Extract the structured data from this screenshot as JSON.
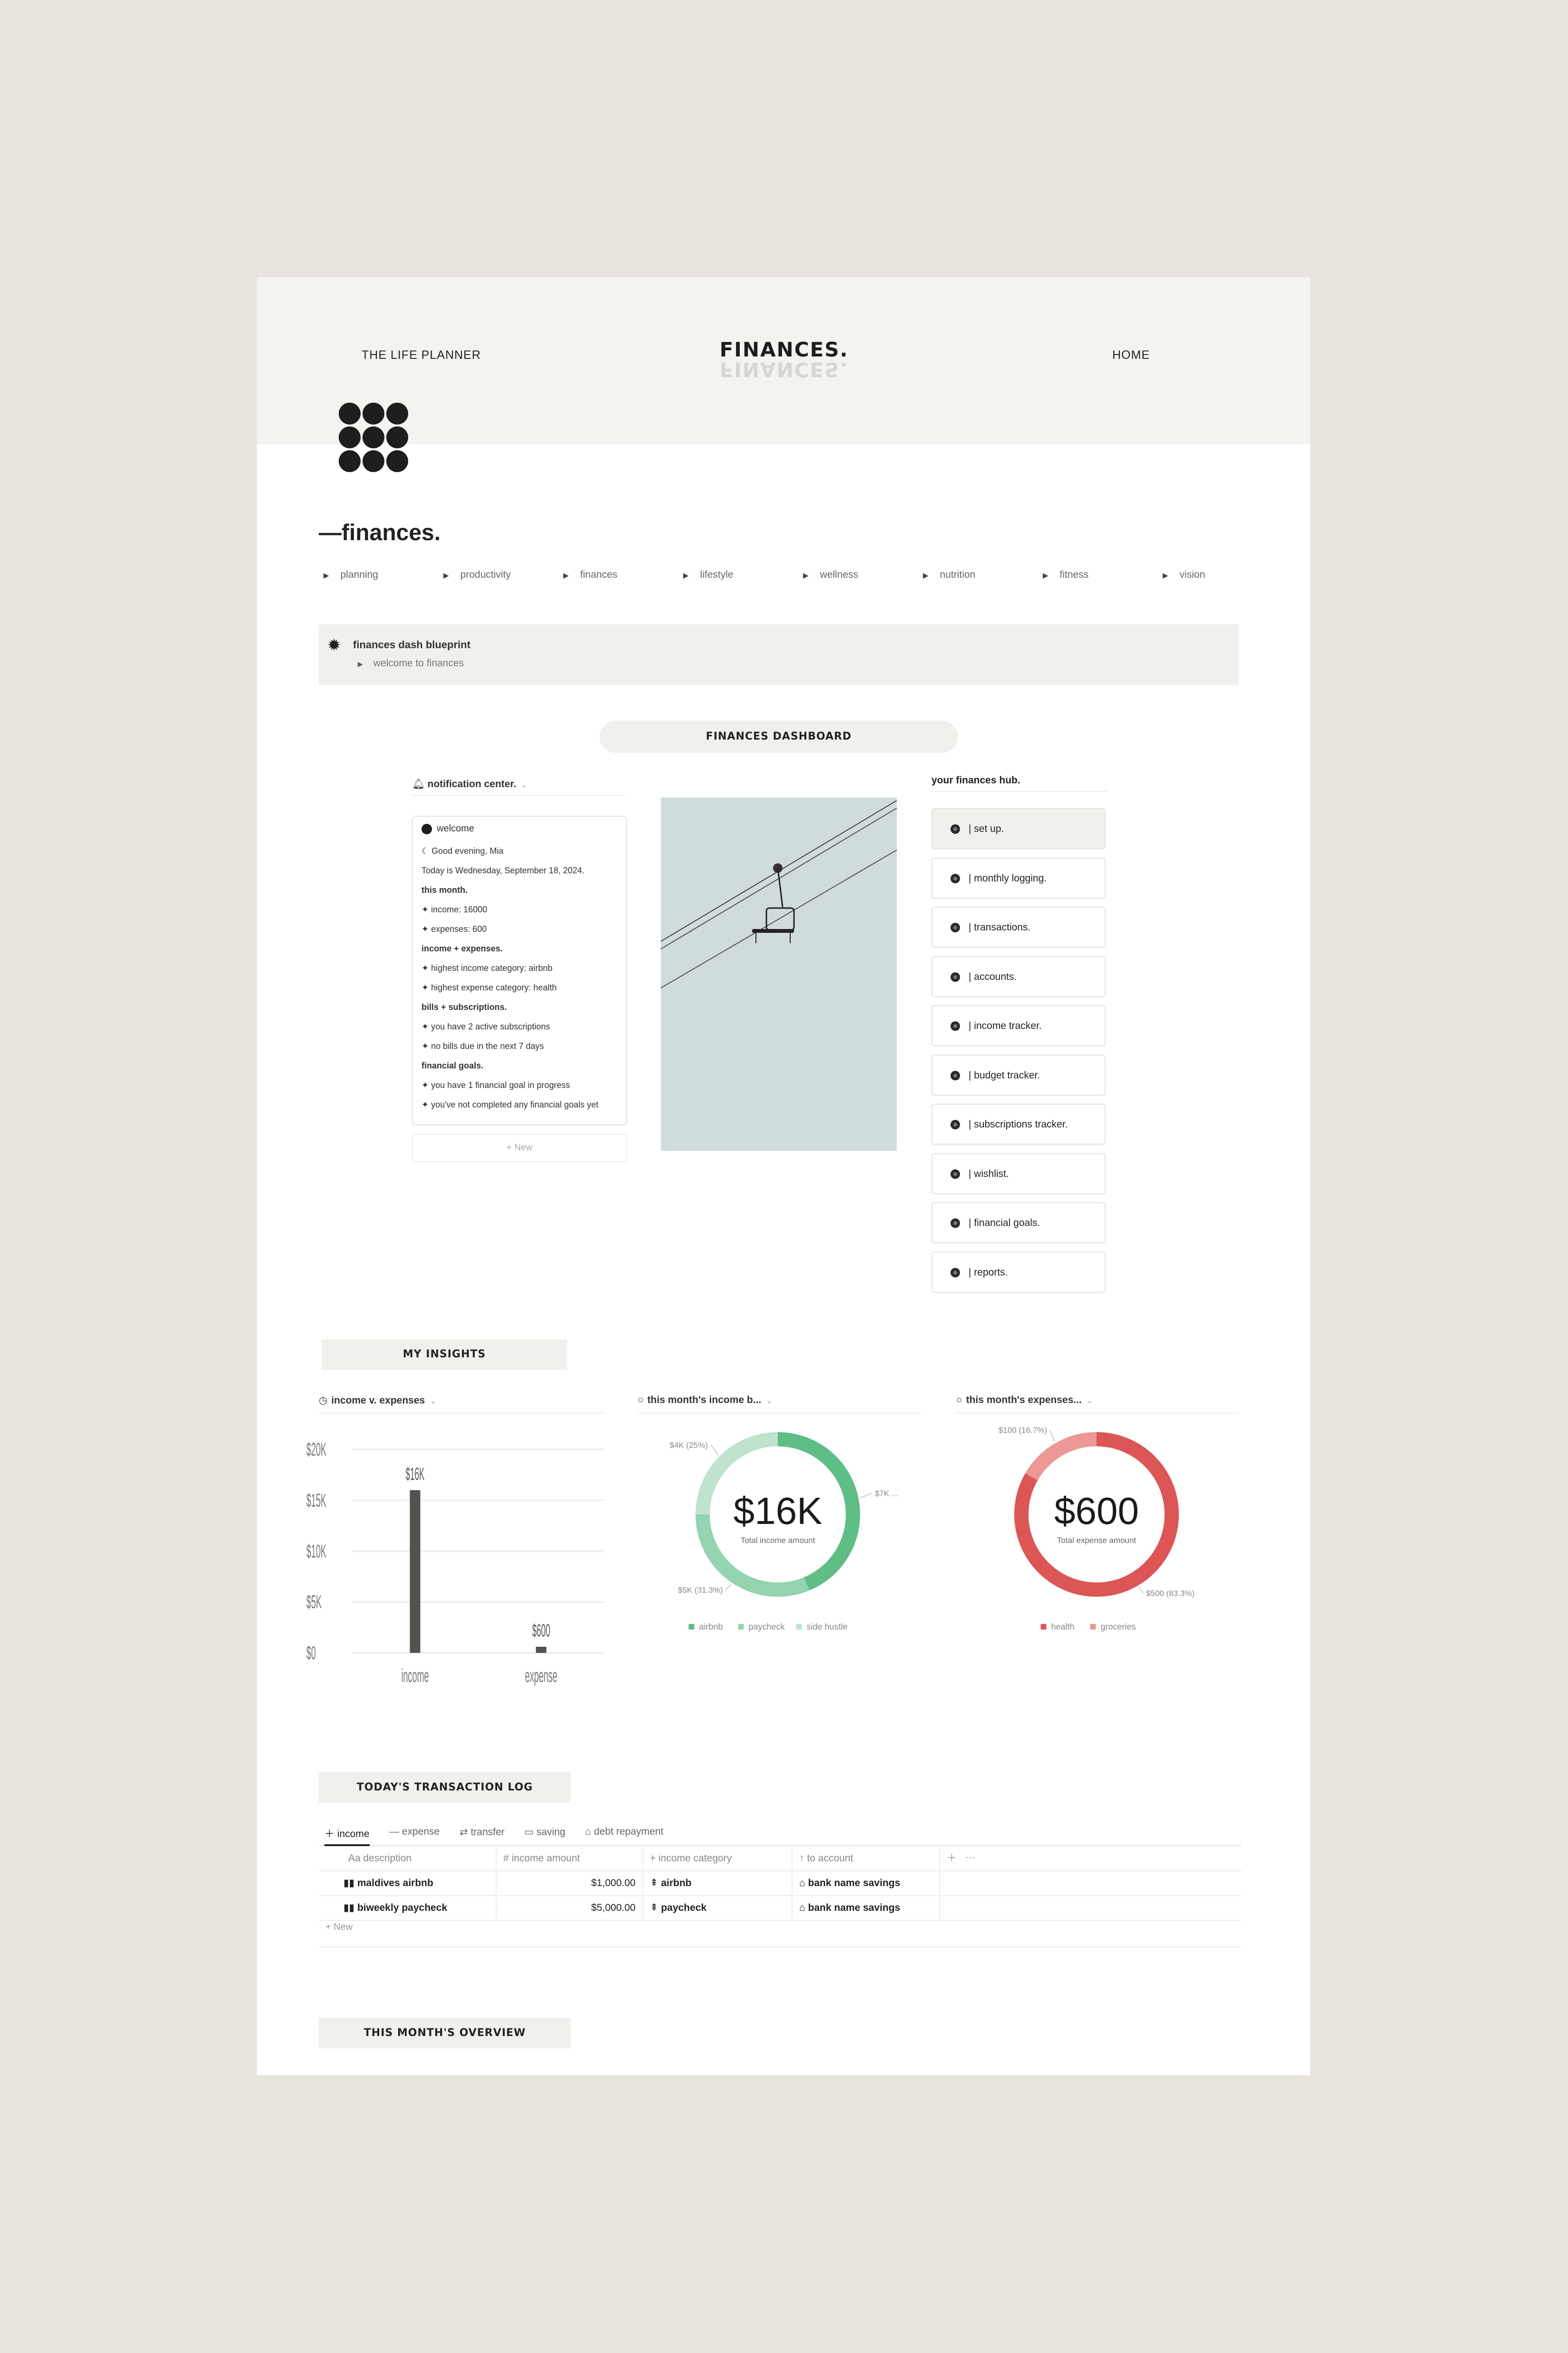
{
  "header": {
    "left_link": "THE LIFE PLANNER",
    "brand": "FINANCES.",
    "right_link": "HOME"
  },
  "page_title": "—finances.",
  "categories": [
    "planning",
    "productivity",
    "finances",
    "lifestyle",
    "wellness",
    "nutrition",
    "fitness",
    "vision"
  ],
  "blueprint": {
    "title": "finances dash blueprint",
    "sub": "welcome to finances"
  },
  "dashboard_label": "FINANCES DASHBOARD",
  "notification": {
    "header": "notification center.",
    "title": "welcome",
    "lines": [
      {
        "text": "Good evening, Mia",
        "bold": false,
        "icon": "moon-icon"
      },
      {
        "text": "Today is Wednesday, September 18, 2024.",
        "bold": false,
        "icon": ""
      },
      {
        "text": "this month.",
        "bold": true,
        "icon": ""
      },
      {
        "text": "income: 16000",
        "bold": false,
        "icon": "sparkle-icon"
      },
      {
        "text": "expenses: 600",
        "bold": false,
        "icon": "sparkle-icon"
      },
      {
        "text": "income + expenses.",
        "bold": true,
        "icon": ""
      },
      {
        "text": "highest income category: airbnb",
        "bold": false,
        "icon": "sparkle-icon"
      },
      {
        "text": "highest expense category: health",
        "bold": false,
        "icon": "sparkle-icon"
      },
      {
        "text": "bills + subscriptions.",
        "bold": true,
        "icon": ""
      },
      {
        "text": "you have 2 active subscriptions",
        "bold": false,
        "icon": "sparkle-icon"
      },
      {
        "text": "no bills due in the next 7 days",
        "bold": false,
        "icon": "sparkle-icon"
      },
      {
        "text": "financial goals.",
        "bold": true,
        "icon": ""
      },
      {
        "text": "you have 1 financial goal in progress",
        "bold": false,
        "icon": "sparkle-icon"
      },
      {
        "text": "you've not completed any financial goals yet",
        "bold": false,
        "icon": "sparkle-icon"
      }
    ],
    "new_label": "+ New"
  },
  "hub": {
    "title": "your finances hub.",
    "items": [
      "| set up.",
      "| monthly logging.",
      "| transactions.",
      "| accounts.",
      "| income tracker.",
      "| budget tracker.",
      "| subscriptions tracker.",
      "| wishlist.",
      "| financial goals.",
      "| reports."
    ]
  },
  "insights_label": "MY INSIGHTS",
  "chart_heads": [
    "income v. expenses",
    "this month's income b...",
    "this month's expenses..."
  ],
  "chart_data": [
    {
      "type": "bar",
      "title": "income v. expenses",
      "categories": [
        "income",
        "expense"
      ],
      "values": [
        16000,
        600
      ],
      "data_labels": [
        "$16K",
        "$600"
      ],
      "yticks": [
        "$0",
        "$5K",
        "$10K",
        "$15K",
        "$20K"
      ],
      "ylim": [
        0,
        20000
      ],
      "grid": true,
      "colors": [
        "#54524d"
      ]
    },
    {
      "type": "pie",
      "title": "this month's income b...",
      "center_value": "$16K",
      "center_label": "Total income amount",
      "slices": [
        {
          "name": "airbnb",
          "value": 7000,
          "label": "$7K ...",
          "color": "#5fbd86"
        },
        {
          "name": "paycheck",
          "value": 5000,
          "label": "$5K (31.3%)",
          "color": "#94d4b0"
        },
        {
          "name": "side hustle",
          "value": 4000,
          "label": "$4K (25%)",
          "color": "#bfe3cd"
        }
      ],
      "legend": [
        "airbnb",
        "paycheck",
        "side hustle"
      ],
      "legend_position": "bottom"
    },
    {
      "type": "pie",
      "title": "this month's expenses...",
      "center_value": "$600",
      "center_label": "Total expense amount",
      "slices": [
        {
          "name": "health",
          "value": 500,
          "label": "$500 (83.3%)",
          "color": "#dc5656"
        },
        {
          "name": "groceries",
          "value": 100,
          "label": "$100 (16.7%)",
          "color": "#ec9894"
        }
      ],
      "legend": [
        "health",
        "groceries"
      ],
      "legend_position": "bottom"
    }
  ],
  "transaction_log_label": "TODAY'S TRANSACTION LOG",
  "tabs": [
    "income",
    "expense",
    "transfer",
    "saving",
    "debt repayment"
  ],
  "table": {
    "columns": [
      "Aa description",
      "# income amount",
      "+ income category",
      "↑ to account"
    ],
    "rows": [
      [
        "maldives airbnb",
        "$1,000.00",
        "airbnb",
        "bank name savings"
      ],
      [
        "biweekly paycheck",
        "$5,000.00",
        "paycheck",
        "bank name savings"
      ]
    ],
    "new_label": "+ New"
  },
  "overview_label": "THIS MONTH'S OVERVIEW"
}
